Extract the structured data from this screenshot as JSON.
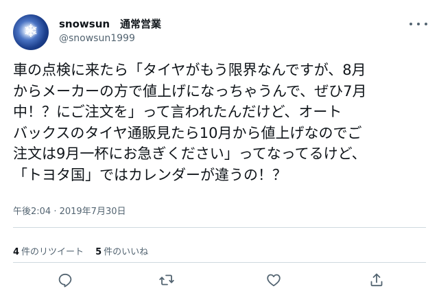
{
  "user": {
    "display_name": "snowsun　通常営業",
    "handle": "@snowsun1999"
  },
  "tweet": {
    "lines": [
      "車の点検に来たら「タイヤがもう限界なんですが、8月",
      "からメーカーの方で値上げになっちゃうんで、ぜひ7月",
      "中！？にご注文を」って言われたんだけど、オート",
      "バックスのタイヤ通販見たら10月から値上げなのでご",
      "注文は9月一杯にお急ぎください」ってなってるけど、",
      "「トヨタ国」ではカレンダーが違うの！？"
    ],
    "timestamp": "午後2:04 · 2019年7月30日"
  },
  "stats": {
    "retweet_count": "4",
    "retweet_label": "件のリツイート",
    "like_count": "5",
    "like_label": "件のいいね"
  },
  "icons": {
    "avatar": "snowflake-avatar",
    "more": "more-dots-icon",
    "reply": "reply-icon",
    "retweet": "retweet-icon",
    "like": "heart-icon",
    "share": "share-icon"
  },
  "colors": {
    "text": "#0f1419",
    "secondary": "#536471",
    "divider": "#cfd9de"
  }
}
